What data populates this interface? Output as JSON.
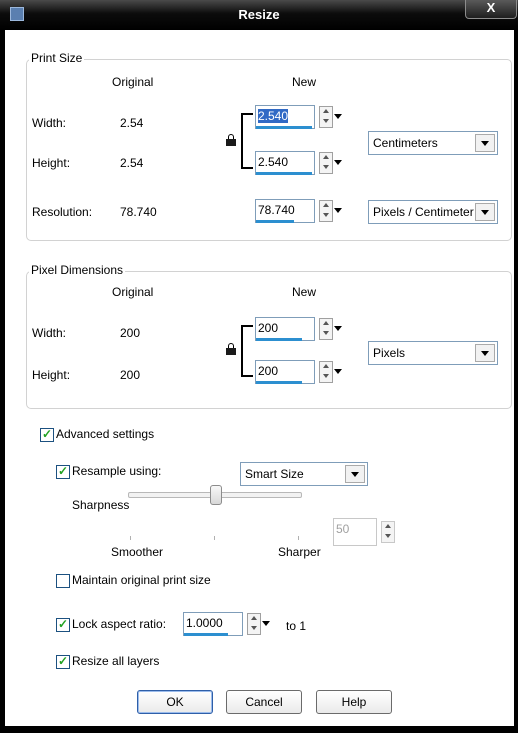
{
  "window": {
    "title": "Resize",
    "close_label": "X"
  },
  "print_size": {
    "legend": "Print Size",
    "col_original": "Original",
    "col_new": "New",
    "width_label": "Width:",
    "width_original": "2.54",
    "width_new": "2.540",
    "height_label": "Height:",
    "height_original": "2.54",
    "height_new": "2.540",
    "unit_select": "Centimeters",
    "resolution_label": "Resolution:",
    "resolution_original": "78.740",
    "resolution_new": "78.740",
    "resolution_unit_select": "Pixels / Centimeter"
  },
  "pixel_dimensions": {
    "legend": "Pixel Dimensions",
    "col_original": "Original",
    "col_new": "New",
    "width_label": "Width:",
    "width_original": "200",
    "width_new": "200",
    "height_label": "Height:",
    "height_original": "200",
    "height_new": "200",
    "unit_select": "Pixels"
  },
  "advanced": {
    "advanced_label": "Advanced settings",
    "advanced_checked": true,
    "resample_label": "Resample using:",
    "resample_checked": true,
    "resample_method": "Smart Size",
    "sharpness_label": "Sharpness",
    "smoother_label": "Smoother",
    "sharper_label": "Sharper",
    "sharpness_value": "50",
    "maintain_label": "Maintain original print size",
    "maintain_checked": false,
    "lock_aspect_label": "Lock aspect ratio:",
    "lock_aspect_checked": true,
    "aspect_value": "1.0000",
    "aspect_suffix": "to 1",
    "resize_layers_label": "Resize all layers",
    "resize_layers_checked": true
  },
  "buttons": {
    "ok": "OK",
    "cancel": "Cancel",
    "help": "Help"
  },
  "colors": {
    "accent_bar": "#2c8fd0",
    "selection": "#316ac5",
    "check": "#21a121"
  }
}
